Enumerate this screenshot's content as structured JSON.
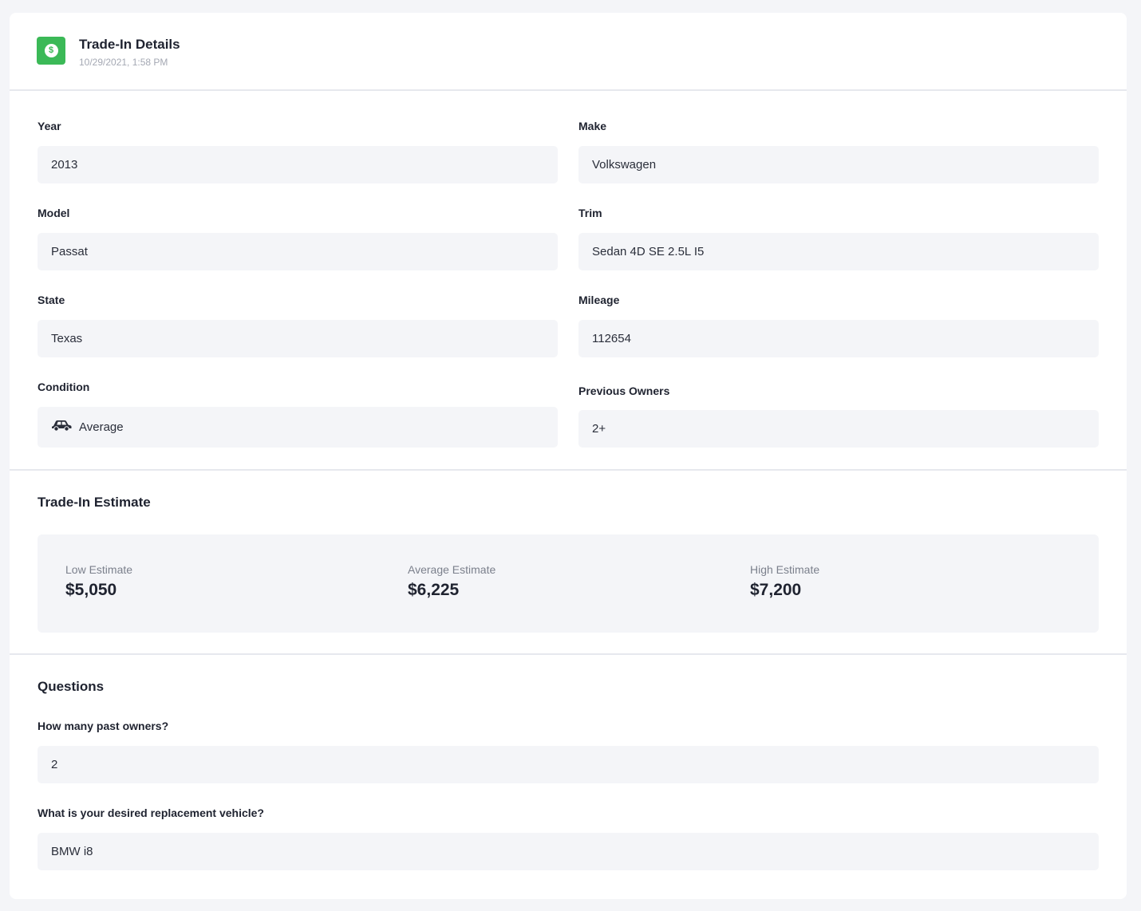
{
  "header": {
    "title": "Trade-In Details",
    "timestamp": "10/29/2021, 1:58 PM",
    "icon": "dollar-coin-icon",
    "icon_color": "#3bb957",
    "icon_glyph": "$"
  },
  "fields": {
    "year": {
      "label": "Year",
      "value": "2013"
    },
    "make": {
      "label": "Make",
      "value": "Volkswagen"
    },
    "model": {
      "label": "Model",
      "value": "Passat"
    },
    "trim": {
      "label": "Trim",
      "value": "Sedan 4D SE 2.5L I5"
    },
    "state": {
      "label": "State",
      "value": "Texas"
    },
    "mileage": {
      "label": "Mileage",
      "value": "112654"
    },
    "condition": {
      "label": "Condition",
      "value": "Average",
      "icon": "car-icon"
    },
    "previous_owners": {
      "label": "Previous Owners",
      "value": "2+"
    }
  },
  "estimate": {
    "title": "Trade-In Estimate",
    "low": {
      "label": "Low Estimate",
      "value": "$5,050"
    },
    "average": {
      "label": "Average Estimate",
      "value": "$6,225"
    },
    "high": {
      "label": "High Estimate",
      "value": "$7,200"
    }
  },
  "questions": {
    "title": "Questions",
    "items": [
      {
        "question": "How many past owners?",
        "answer": "2"
      },
      {
        "question": "What is your desired replacement vehicle?",
        "answer": "BMW i8"
      }
    ]
  }
}
